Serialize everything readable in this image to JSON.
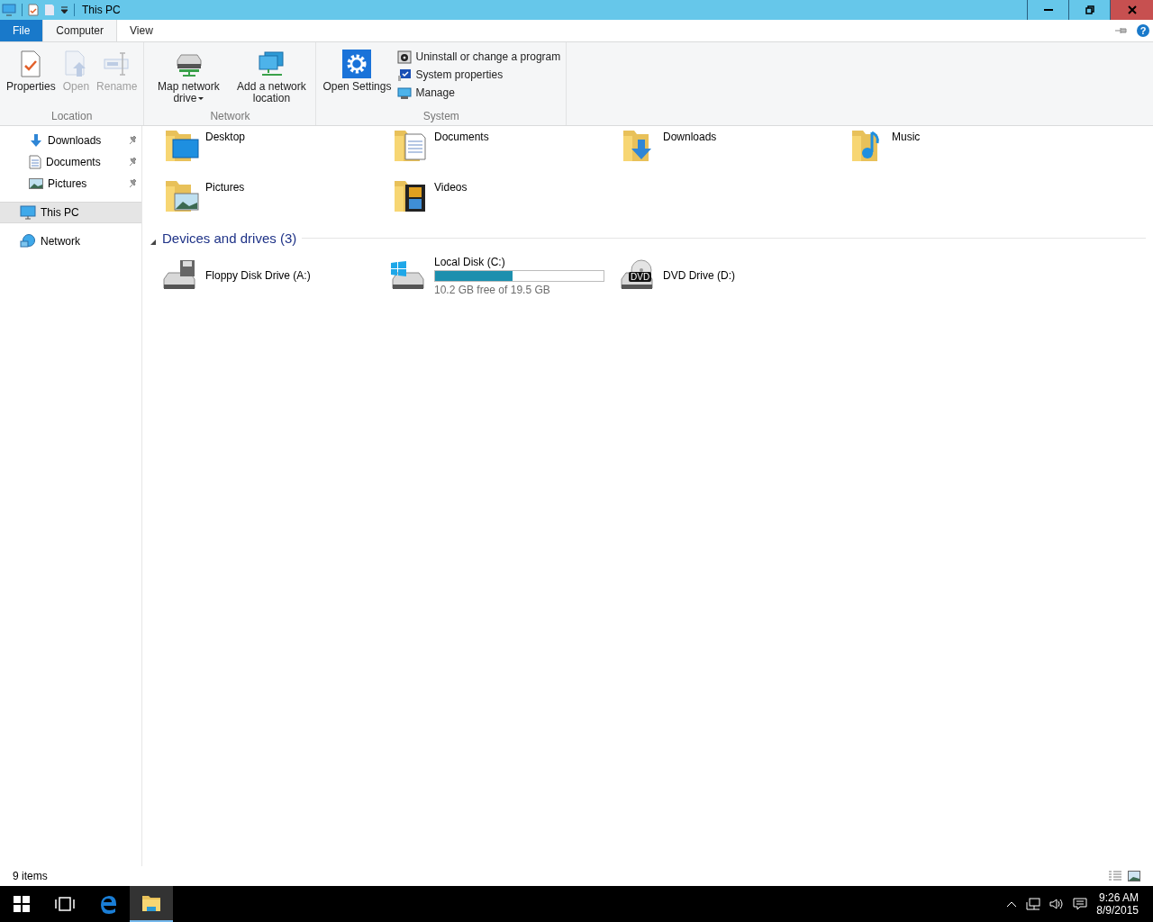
{
  "window": {
    "title": "This PC"
  },
  "ribbon_tabs": [
    {
      "label": "File",
      "kind": "file",
      "selected": false
    },
    {
      "label": "Computer",
      "kind": "tab",
      "selected": true
    },
    {
      "label": "View",
      "kind": "tab",
      "selected": false
    }
  ],
  "help": {
    "label": "?"
  },
  "ribbon_groups": [
    {
      "label": "Location",
      "buttons": [
        {
          "label": "Properties",
          "kind": "properties",
          "disabled": false
        },
        {
          "label": "Open",
          "kind": "open",
          "disabled": true
        },
        {
          "label": "Rename",
          "kind": "rename",
          "disabled": true
        }
      ]
    },
    {
      "label": "Network",
      "buttons": [
        {
          "label": "Map network drive",
          "kind": "map-drive",
          "disabled": false,
          "dropdown": true
        },
        {
          "label": "Add a network location",
          "kind": "add-location",
          "disabled": false
        }
      ]
    },
    {
      "label": "System",
      "buttons": [
        {
          "label": "Open Settings",
          "kind": "settings",
          "disabled": false
        }
      ],
      "small_buttons": [
        {
          "label": "Uninstall or change a program",
          "kind": "uninstall"
        },
        {
          "label": "System properties",
          "kind": "sysprops"
        },
        {
          "label": "Manage",
          "kind": "manage"
        }
      ]
    }
  ],
  "quick_access": [
    {
      "label": "Downloads",
      "kind": "downloads",
      "pinned": true
    },
    {
      "label": "Documents",
      "kind": "documents",
      "pinned": true
    },
    {
      "label": "Pictures",
      "kind": "pictures",
      "pinned": true
    }
  ],
  "nav_roots": [
    {
      "label": "This PC",
      "kind": "pc",
      "selected": true
    },
    {
      "label": "Network",
      "kind": "network",
      "selected": false
    }
  ],
  "folders": [
    {
      "label": "Desktop",
      "kind": "desktop"
    },
    {
      "label": "Documents",
      "kind": "documents"
    },
    {
      "label": "Downloads",
      "kind": "downloads"
    },
    {
      "label": "Music",
      "kind": "music"
    },
    {
      "label": "Pictures",
      "kind": "pictures"
    },
    {
      "label": "Videos",
      "kind": "videos"
    }
  ],
  "devices": {
    "title": "Devices and drives (3)",
    "expanded": true,
    "drives": [
      {
        "label": "Floppy Disk Drive (A:)",
        "kind": "floppy"
      },
      {
        "label": "Local Disk (C:)",
        "kind": "disk",
        "level": 0.46,
        "free": "10.2 GB free of 19.5 GB"
      },
      {
        "label": "DVD Drive (D:)",
        "kind": "dvd",
        "badge": "DVD"
      }
    ]
  },
  "status_bar": {
    "count": "9 items"
  },
  "taskbar": {
    "apps": [
      {
        "kind": "task-view",
        "selected": false
      },
      {
        "kind": "edge",
        "selected": false
      },
      {
        "kind": "explorer",
        "selected": true
      }
    ],
    "time": "9:26 AM",
    "date": "8/9/2015"
  }
}
